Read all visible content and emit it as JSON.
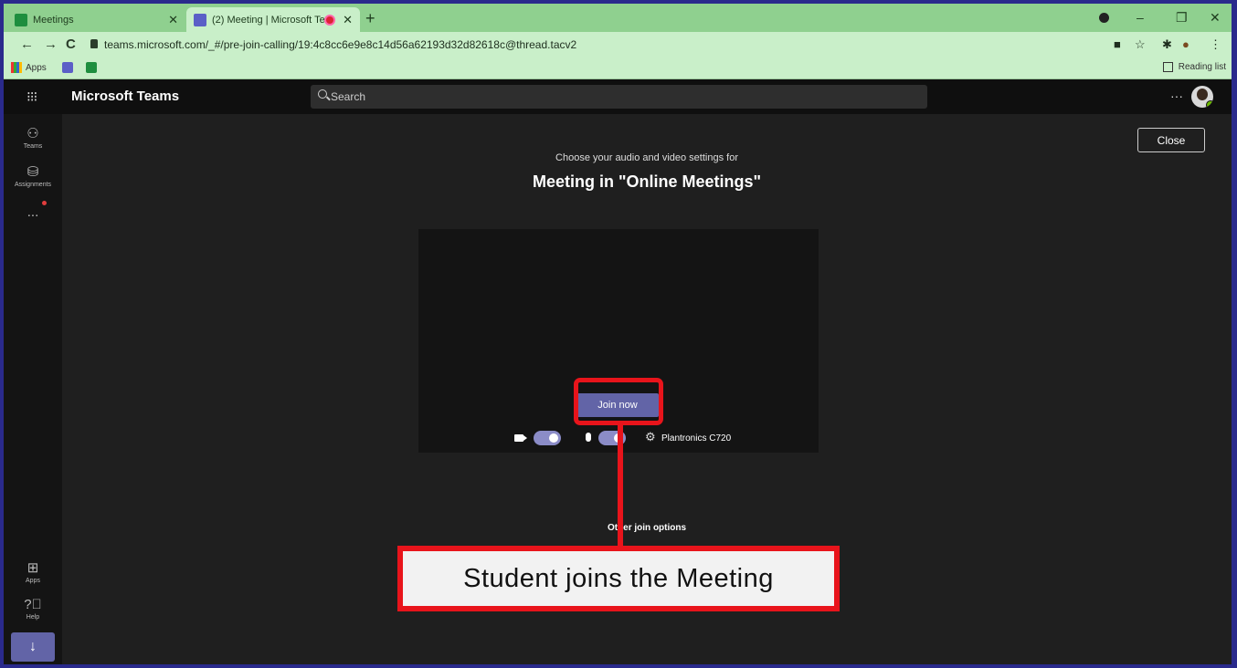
{
  "browser": {
    "tabs": [
      {
        "title": "Meetings",
        "icon": "calendar-favicon",
        "active": false
      },
      {
        "title": "(2) Meeting | Microsoft Teams",
        "icon": "teams-favicon",
        "active": true,
        "recording": true
      }
    ],
    "url": "teams.microsoft.com/_#/pre-join-calling/19:4c8cc6e9e8c14d56a62193d32d82618c@thread.tacv2",
    "bookmarks": [
      {
        "label": "Apps",
        "icon": "apps-grid-icon"
      },
      {
        "label": "",
        "icon": "teams-icon"
      },
      {
        "label": "",
        "icon": "calendar-icon"
      }
    ],
    "reading_list": "Reading list",
    "colors": {
      "frame": "#8fd08f",
      "toolbar": "#c9efc9"
    }
  },
  "teams": {
    "app_title": "Microsoft Teams",
    "search_placeholder": "Search",
    "rail": {
      "items": [
        {
          "label": "Teams",
          "icon": "teams-people-icon"
        },
        {
          "label": "Assignments",
          "icon": "assignments-icon"
        },
        {
          "label": "...",
          "icon": "more-icon"
        }
      ],
      "bottom": [
        {
          "label": "Apps",
          "icon": "apps-icon"
        },
        {
          "label": "Help",
          "icon": "help-icon"
        }
      ]
    },
    "accent": "#6264a7"
  },
  "prejoin": {
    "close_label": "Close",
    "subtitle": "Choose your audio and video settings for",
    "meeting_title": "Meeting in \"Online Meetings\"",
    "join_label": "Join now",
    "camera_on": true,
    "mic_on": true,
    "device_name": "Plantronics C720",
    "other_join_options": "Other join options"
  },
  "annotation": {
    "callout_text": "Student joins the Meeting",
    "color": "#e8141b"
  }
}
